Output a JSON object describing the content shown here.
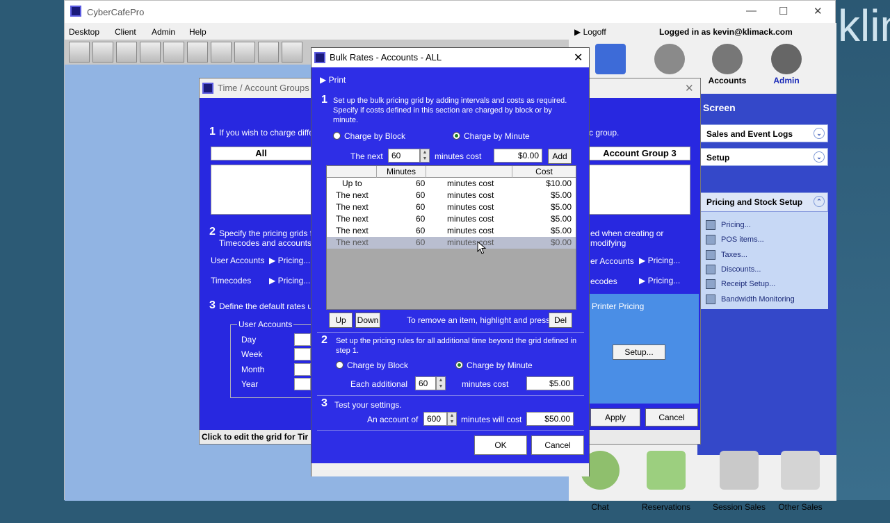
{
  "app": {
    "title": "CyberCafePro",
    "menu": [
      "Desktop",
      "Client",
      "Admin",
      "Help"
    ],
    "logoff": "Logoff",
    "logged_in": "Logged in as kevin@klimack.com"
  },
  "top_icons": [
    "Accounts",
    "Admin"
  ],
  "nav": {
    "screen": "Screen",
    "groups": [
      "Sales and Event Logs",
      "Setup",
      "Pricing and Stock Setup"
    ],
    "items": [
      "Pricing...",
      "POS items...",
      "Taxes...",
      "Discounts...",
      "Receipt Setup...",
      "Bandwidth Monitoring"
    ]
  },
  "bottom_icons": [
    "Chat",
    "Reservations",
    "Session Sales",
    "Other Sales"
  ],
  "bg_text": "klin",
  "time_window": {
    "title": "Time / Account Groups",
    "step1": "If you wish to charge differ",
    "group_all": "All",
    "group3": "Account Group 3",
    "group_hint": "c group.",
    "step2a": "Specify the pricing grids fo",
    "step2b": "Timecodes and accounts.",
    "step2_right": "ed when creating or modifying",
    "user_accounts": "User Accounts",
    "timecodes": "Timecodes",
    "pricing": "Pricing...",
    "user_accounts_r": "er Accounts",
    "timecodes_r": "ecodes",
    "step3": "Define the default rates us",
    "ua_box": "User Accounts",
    "periods": [
      "Day",
      "Week",
      "Month",
      "Year"
    ],
    "printer_pricing": "Printer Pricing",
    "setup": "Setup...",
    "apply": "Apply",
    "cancel": "Cancel",
    "status": "Click to edit the grid for Tir"
  },
  "dialog": {
    "title": "Bulk Rates - Accounts - ALL",
    "print": "Print",
    "step1": "Set up the bulk pricing grid by adding intervals and costs as required. Specify if costs defined in this section are charged by block or by minute.",
    "charge_block": "Charge by Block",
    "charge_minute": "Charge by Minute",
    "the_next": "The next",
    "next_minutes": "60",
    "minutes_cost": "minutes cost",
    "next_cost": "$0.00",
    "add": "Add",
    "grid_headers": [
      "Minutes",
      "Cost"
    ],
    "rows": [
      {
        "label": "Up to",
        "minutes": "60",
        "unit": "minutes cost",
        "cost": "$10.00"
      },
      {
        "label": "The next",
        "minutes": "60",
        "unit": "minutes cost",
        "cost": "$5.00"
      },
      {
        "label": "The next",
        "minutes": "60",
        "unit": "minutes cost",
        "cost": "$5.00"
      },
      {
        "label": "The next",
        "minutes": "60",
        "unit": "minutes cost",
        "cost": "$5.00"
      },
      {
        "label": "The next",
        "minutes": "60",
        "unit": "minutes cost",
        "cost": "$5.00"
      },
      {
        "label": "The next",
        "minutes": "60",
        "unit": "minutes cost",
        "cost": "$0.00"
      }
    ],
    "up": "Up",
    "down": "Down",
    "remove_hint": "To remove an item, highlight and press",
    "del": "Del",
    "step2": "Set up the pricing rules for all additional time beyond the grid defined in step 1.",
    "each_additional": "Each additional",
    "additional_minutes": "60",
    "additional_cost": "$5.00",
    "step3": "Test your settings.",
    "an_account_of": "An account of",
    "test_minutes": "600",
    "minutes_will_cost": "minutes will cost",
    "test_cost": "$50.00",
    "ok": "OK",
    "cancel": "Cancel"
  }
}
